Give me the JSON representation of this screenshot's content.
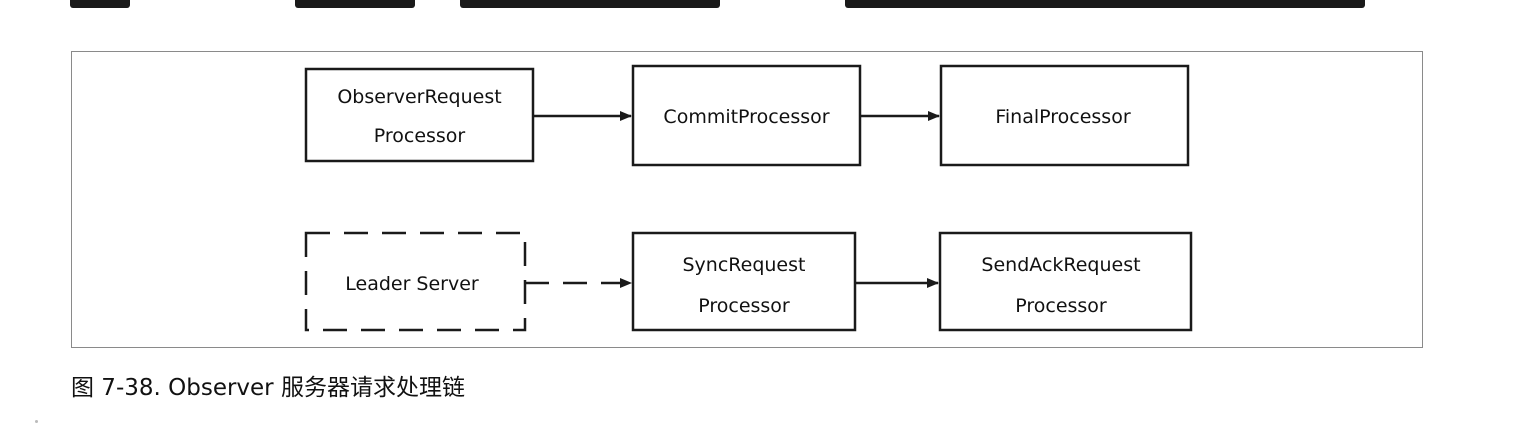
{
  "caption": "图 7-38. Observer 服务器请求处理链",
  "diagram": {
    "row1": [
      {
        "line1": "ObserverRequest",
        "line2": "Processor"
      },
      {
        "line1": "CommitProcessor",
        "line2": ""
      },
      {
        "line1": "FinalProcessor",
        "line2": ""
      }
    ],
    "row2": [
      {
        "line1": "Leader Server",
        "line2": "",
        "style": "dashed"
      },
      {
        "line1": "SyncRequest",
        "line2": "Processor"
      },
      {
        "line1": "SendAckRequest",
        "line2": "Processor"
      }
    ]
  },
  "colors": {
    "stroke": "#1a1a1a",
    "frame": "#8a8a8a",
    "text": "#111111"
  }
}
